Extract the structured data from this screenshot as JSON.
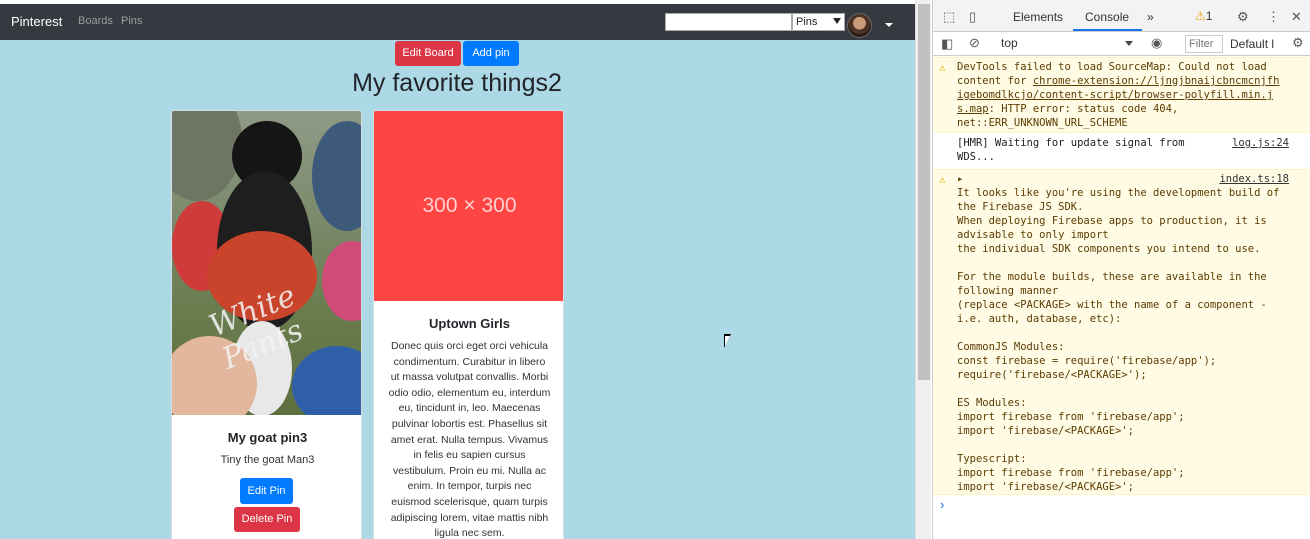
{
  "app": {
    "brand": "Pinterest",
    "nav": {
      "boards": "Boards",
      "pins": "Pins"
    },
    "search": {
      "value": "",
      "placeholder": ""
    },
    "scope_select": {
      "selected": "Pins"
    },
    "actions": {
      "edit_board": "Edit Board",
      "add_pin": "Add pin"
    },
    "board_title": "My favorite things2",
    "pins": [
      {
        "title": "My goat pin3",
        "description": "Tiny the goat Man3",
        "image_caption": "White Pants",
        "edit_label": "Edit Pin",
        "delete_label": "Delete Pin"
      },
      {
        "title": "Uptown Girls",
        "placeholder_text": "300 × 300",
        "body": "Donec quis orci eget orci vehicula condimentum. Curabitur in libero ut massa volutpat convallis. Morbi odio odio, elementum eu, interdum eu, tincidunt in, leo. Maecenas pulvinar lobortis est. Phasellus sit amet erat. Nulla tempus. Vivamus in felis eu sapien cursus vestibulum. Proin eu mi. Nulla ac enim. In tempor, turpis nec euismod scelerisque, quam turpis adipiscing lorem, vitae mattis nibh ligula nec sem."
      }
    ],
    "colors": {
      "background": "#add8e6",
      "navbar": "#343a40",
      "primary": "#007bff",
      "danger": "#dc3545",
      "placeholder": "#ff4444"
    }
  },
  "devtools": {
    "tabs": {
      "elements": "Elements",
      "console": "Console",
      "more": "»"
    },
    "warning_count": "1",
    "toolbar": {
      "context": "top",
      "filter_placeholder": "Filter",
      "levels": "Default l"
    },
    "messages": [
      {
        "level": "warning",
        "text_1": "DevTools failed to load SourceMap: Could not load",
        "text_2": "content for ",
        "link": "chrome-extension://ljngjbnaijcbncmcnjfh\nigebomdlkcjo/content-script/browser-polyfill.min.j\ns.map",
        "text_3": ": HTTP error: status code 404,\nnet::ERR_UNKNOWN_URL_SCHEME"
      },
      {
        "level": "info",
        "text": "[HMR] Waiting for update signal from\nWDS...",
        "source": "log.js:24"
      },
      {
        "level": "warning",
        "source": "index.ts:18",
        "text": "▸\nIt looks like you're using the development build of\nthe Firebase JS SDK.\nWhen deploying Firebase apps to production, it is\nadvisable to only import\nthe individual SDK components you intend to use.\n\nFor the module builds, these are available in the\nfollowing manner\n(replace <PACKAGE> with the name of a component -\ni.e. auth, database, etc):\n\nCommonJS Modules:\nconst firebase = require('firebase/app');\nrequire('firebase/<PACKAGE>');\n\nES Modules:\nimport firebase from 'firebase/app';\nimport 'firebase/<PACKAGE>';\n\nTypescript:\nimport firebase from 'firebase/app';\nimport 'firebase/<PACKAGE>';"
      }
    ],
    "prompt": "›"
  }
}
